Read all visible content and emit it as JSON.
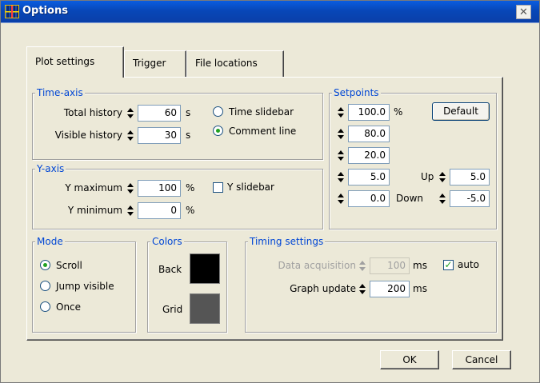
{
  "window": {
    "title": "Options",
    "close_glyph": "✕"
  },
  "tabs": [
    {
      "label": "Plot settings",
      "active": true
    },
    {
      "label": "Trigger",
      "active": false
    },
    {
      "label": "File locations",
      "active": false
    }
  ],
  "time_axis": {
    "title": "Time-axis",
    "total_history": {
      "label": "Total history",
      "value": "60",
      "unit": "s"
    },
    "visible_history": {
      "label": "Visible history",
      "value": "30",
      "unit": "s"
    },
    "options": [
      {
        "label": "Time slidebar",
        "selected": false
      },
      {
        "label": "Comment line",
        "selected": true
      }
    ]
  },
  "y_axis": {
    "title": "Y-axis",
    "y_maximum": {
      "label": "Y maximum",
      "value": "100",
      "unit": "%"
    },
    "y_minimum": {
      "label": "Y minimum",
      "value": "0",
      "unit": "%"
    },
    "y_slidebar": {
      "label": "Y slidebar",
      "checked": false
    }
  },
  "setpoints": {
    "title": "Setpoints",
    "unit": "%",
    "values": [
      "100.0",
      "80.0",
      "20.0",
      "5.0",
      "0.0"
    ],
    "default_label": "Default",
    "up": {
      "label": "Up",
      "value": "5.0"
    },
    "down": {
      "label": "Down",
      "value": "-5.0"
    }
  },
  "mode": {
    "title": "Mode",
    "options": [
      {
        "label": "Scroll",
        "selected": true
      },
      {
        "label": "Jump visible",
        "selected": false
      },
      {
        "label": "Once",
        "selected": false
      }
    ]
  },
  "colors": {
    "title": "Colors",
    "back": {
      "label": "Back",
      "color": "#000000"
    },
    "grid": {
      "label": "Grid",
      "color": "#555555"
    }
  },
  "timing": {
    "title": "Timing settings",
    "data_acquisition": {
      "label": "Data acquisition",
      "value": "100",
      "unit": "ms",
      "enabled": false
    },
    "auto": {
      "label": "auto",
      "checked": true
    },
    "graph_update": {
      "label": "Graph update",
      "value": "200",
      "unit": "ms"
    }
  },
  "buttons": {
    "ok": "OK",
    "cancel": "Cancel"
  }
}
